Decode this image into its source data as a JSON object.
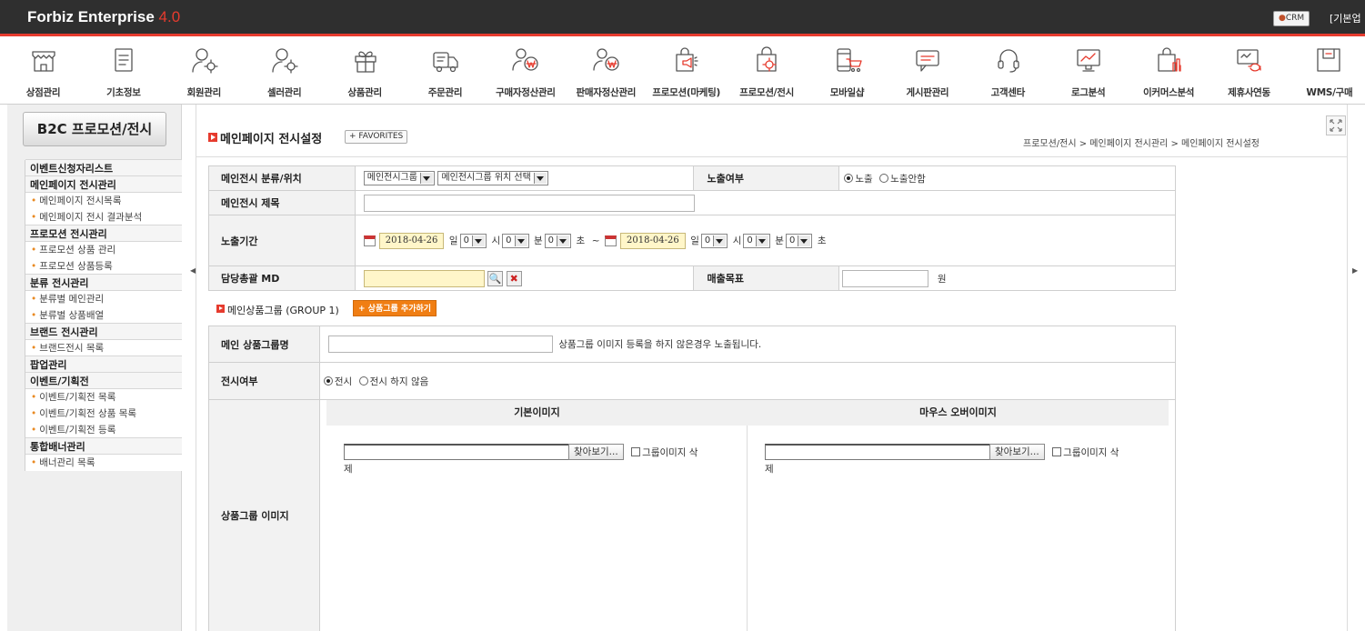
{
  "app": {
    "brand": "Forbiz Enterprise",
    "version": "4.0",
    "crm_label": "CRM",
    "top_link": "[기본업"
  },
  "menu": [
    {
      "label": "상점관리",
      "icon": "store-icon"
    },
    {
      "label": "기초정보",
      "icon": "document-icon"
    },
    {
      "label": "회원관리",
      "icon": "member-gear-icon"
    },
    {
      "label": "셀러관리",
      "icon": "seller-gear-icon"
    },
    {
      "label": "상품관리",
      "icon": "gift-box-icon"
    },
    {
      "label": "주문관리",
      "icon": "truck-icon"
    },
    {
      "label": "구매자정산관리",
      "icon": "buyer-won-icon"
    },
    {
      "label": "판매자정산관리",
      "icon": "seller-won-icon"
    },
    {
      "label": "프로모션(마케팅)",
      "icon": "megaphone-bag-icon"
    },
    {
      "label": "프로모션/전시",
      "icon": "bag-gear-icon"
    },
    {
      "label": "모바일샵",
      "icon": "mobile-cart-icon"
    },
    {
      "label": "게시판관리",
      "icon": "board-icon"
    },
    {
      "label": "고객센타",
      "icon": "headset-icon"
    },
    {
      "label": "로그분석",
      "icon": "monitor-chart-icon"
    },
    {
      "label": "이커머스분석",
      "icon": "bag-chart-icon"
    },
    {
      "label": "제휴사연동",
      "icon": "sync-icon"
    },
    {
      "label": "WMS/구매",
      "icon": "warehouse-icon"
    }
  ],
  "sidebar": {
    "title": "B2C 프로모션/전시",
    "groups": [
      {
        "label": "이벤트신청자리스트",
        "items": []
      },
      {
        "label": "메인페이지 전시관리",
        "items": [
          "메인페이지 전시목록",
          "메인페이지 전시 결과분석"
        ]
      },
      {
        "label": "프로모션 전시관리",
        "items": [
          "프로모션 상품 관리",
          "프로모션 상품등록"
        ]
      },
      {
        "label": "분류 전시관리",
        "items": [
          "분류별 메인관리",
          "분류별 상품배열"
        ]
      },
      {
        "label": "브랜드 전시관리",
        "items": [
          "브랜드전시 목록"
        ]
      },
      {
        "label": "팝업관리",
        "items": []
      },
      {
        "label": "이벤트/기획전",
        "items": [
          "이벤트/기획전 목록",
          "이벤트/기획전 상품 목록",
          "이벤트/기획전 등록"
        ]
      },
      {
        "label": "통합배너관리",
        "items": [
          "배너관리 목록"
        ]
      }
    ]
  },
  "page": {
    "title": "메인페이지 전시설정",
    "favorites": "+ FAVORITES",
    "breadcrumb": "프로모션/전시 > 메인페이지 전시관리 > 메인페이지 전시설정"
  },
  "form": {
    "category_label": "메인전시 분류/위치",
    "category_select": "메인전시그룹",
    "position_select": "메인전시그룹 위치 선택",
    "display_label": "노출여부",
    "display_on": "노출",
    "display_off": "노출안함",
    "title_label": "메인전시 제목",
    "title_value": "",
    "period_label": "노출기간",
    "start_date": "2018-04-26",
    "end_date": "2018-04-26",
    "day_unit": "일",
    "hour_unit": "시",
    "minute_unit": "분",
    "second_unit": "초",
    "zero": "0",
    "tilde": "~",
    "md_label": "담당총괄 MD",
    "sales_label": "매출목표",
    "sales_unit": "원"
  },
  "group": {
    "title": "메인상품그룹 (GROUP 1)",
    "add_button": "+ 상품그룹 추가하기",
    "name_label": "메인 상품그룹명",
    "name_hint": "상품그룹 이미지 등록을 하지 않은경우 노출됩니다.",
    "show_label": "전시여부",
    "show_on": "전시",
    "show_off": "전시 하지 않음",
    "image_label": "상품그룹 이미지",
    "basic_image": "기본이미지",
    "hover_image": "마우스 오버이미지",
    "browse": "찾아보기...",
    "delete_prefix": "그룹이미지 삭",
    "delete_suffix": "제"
  }
}
